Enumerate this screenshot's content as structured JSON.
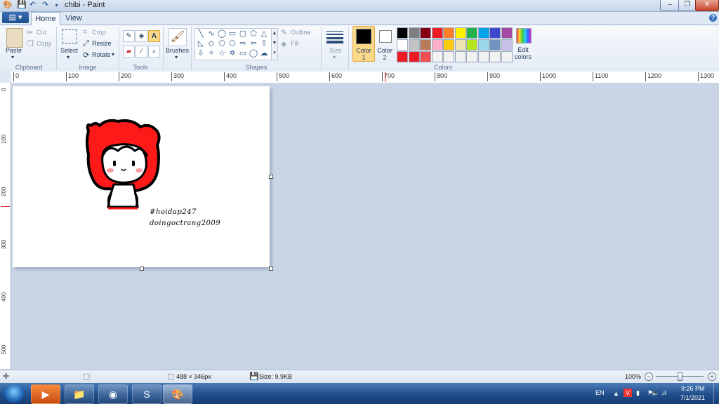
{
  "window": {
    "title": "chibi - Paint",
    "minimize_glyph": "–",
    "maximize_glyph": "❐",
    "close_glyph": "✕"
  },
  "quick_access": {
    "save_icon": "save-icon",
    "undo_icon": "undo-icon",
    "redo_icon": "redo-icon"
  },
  "tabs": {
    "file": "▤ ▾",
    "home": "Home",
    "view": "View"
  },
  "help": "?",
  "clipboard": {
    "paste": "Paste",
    "cut": "Cut",
    "copy": "Copy",
    "label": "Clipboard"
  },
  "image": {
    "select": "Select",
    "crop": "Crop",
    "resize": "Resize",
    "rotate": "Rotate",
    "label": "Image"
  },
  "tools": {
    "label": "Tools",
    "text_glyph": "A"
  },
  "brushes": {
    "label": "Brushes"
  },
  "shapes": {
    "label": "Shapes",
    "outline": "Outline",
    "fill": "Fill"
  },
  "size": {
    "label": "Size"
  },
  "colors": {
    "label": "Colors",
    "color1": "Color 1",
    "color2": "Color 2",
    "edit": "Edit colors",
    "row1": [
      "#000000",
      "#7f7f7f",
      "#880015",
      "#ed1c24",
      "#ff7f27",
      "#fff200",
      "#22b14c",
      "#00a2e8",
      "#3f48cc",
      "#a349a4"
    ],
    "row2": [
      "#ffffff",
      "#c3c3c3",
      "#b97a57",
      "#ffaec9",
      "#ffc90e",
      "#efe4b0",
      "#b5e61d",
      "#99d9ea",
      "#7092be",
      "#c8bfe7"
    ],
    "row3": [
      "#ed1c24",
      "#ed1c24",
      "#f25050",
      "#f2f2f2",
      "#f2f2f2",
      "#f2f2f2",
      "#f2f2f2",
      "#f2f2f2",
      "#f2f2f2",
      "#f2f2f2"
    ]
  },
  "ruler": {
    "h_labels": [
      "0",
      "100",
      "200",
      "300",
      "400",
      "500",
      "600",
      "700",
      "800",
      "900",
      "1000",
      "1100",
      "1200",
      "1300"
    ],
    "v_labels": [
      "0",
      "100",
      "200",
      "300",
      "400",
      "500"
    ]
  },
  "canvas": {
    "signature_line1": "#hoidap247",
    "signature_line2": "doingoctrang2009"
  },
  "status": {
    "dimensions": "488 × 346px",
    "size": "Size: 9.9KB",
    "zoom": "100%"
  },
  "tray": {
    "lang": "EN",
    "time": "9:26 PM",
    "date": "7/1/2021"
  }
}
